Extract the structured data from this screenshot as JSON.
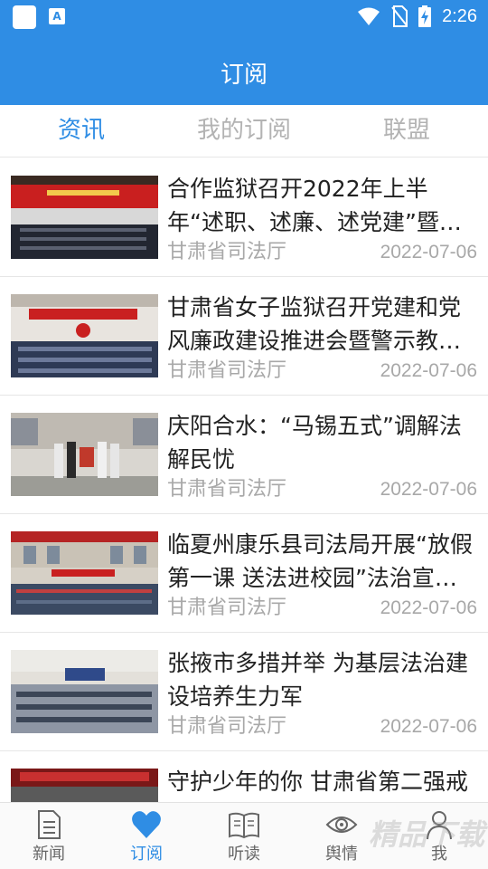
{
  "status_bar": {
    "time": "2:26"
  },
  "header": {
    "title": "订阅"
  },
  "tabs": [
    {
      "label": "资讯",
      "active": true
    },
    {
      "label": "我的订阅",
      "active": false
    },
    {
      "label": "联盟",
      "active": false
    }
  ],
  "articles": [
    {
      "title": "合作监狱召开2022年上半年“述职、述廉、述党建”暨…",
      "source": "甘肃省司法厅",
      "date": "2022-07-06"
    },
    {
      "title": "甘肃省女子监狱召开党建和党风廉政建设推进会暨警示教…",
      "source": "甘肃省司法厅",
      "date": "2022-07-06"
    },
    {
      "title": "庆阳合水：“马锡五式”调解法解民忧",
      "source": "甘肃省司法厅",
      "date": "2022-07-06"
    },
    {
      "title": "临夏州康乐县司法局开展“放假第一课 送法进校园”法治宣…",
      "source": "甘肃省司法厅",
      "date": "2022-07-06"
    },
    {
      "title": "张掖市多措并举 为基层法治建设培养生力军",
      "source": "甘肃省司法厅",
      "date": "2022-07-06"
    },
    {
      "title": "守护少年的你 甘肃省第二强戒",
      "source": "",
      "date": ""
    }
  ],
  "bottom_nav": [
    {
      "label": "新闻",
      "icon": "news-document-icon",
      "active": false
    },
    {
      "label": "订阅",
      "icon": "heart-icon",
      "active": true
    },
    {
      "label": "听读",
      "icon": "open-book-icon",
      "active": false
    },
    {
      "label": "舆情",
      "icon": "eye-icon",
      "active": false
    },
    {
      "label": "我",
      "icon": "person-icon",
      "active": false
    }
  ],
  "watermark": "精品下载",
  "colors": {
    "accent": "#2f8de4",
    "inactive_tab": "#b3b3b3",
    "meta_text": "#a8a8a8"
  }
}
